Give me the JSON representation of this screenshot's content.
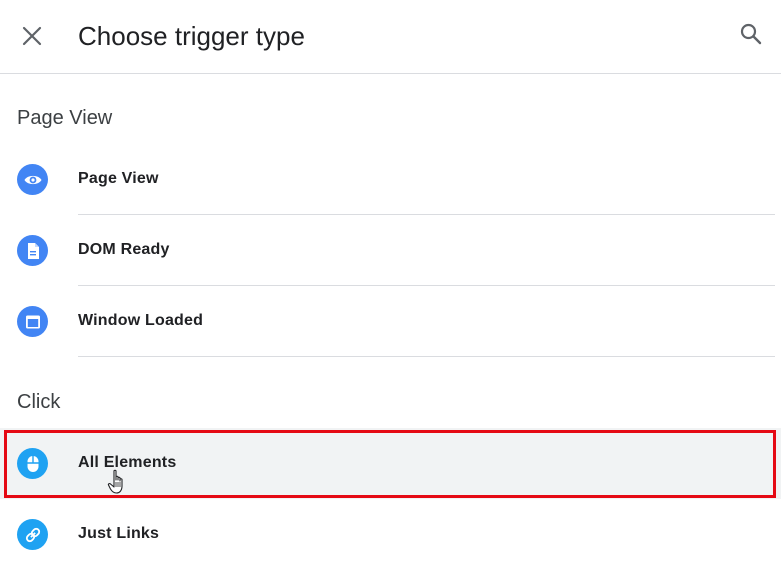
{
  "header": {
    "title": "Choose trigger type",
    "close_icon": "close-icon",
    "search_icon": "search-icon"
  },
  "sections": [
    {
      "title": "Page View",
      "items": [
        {
          "label": "Page View",
          "icon": "eye-icon",
          "color": "#4285f4"
        },
        {
          "label": "DOM Ready",
          "icon": "document-icon",
          "color": "#4285f4"
        },
        {
          "label": "Window Loaded",
          "icon": "window-icon",
          "color": "#4285f4"
        }
      ]
    },
    {
      "title": "Click",
      "items": [
        {
          "label": "All Elements",
          "icon": "mouse-icon",
          "color": "#1fa2f2",
          "highlighted": true
        },
        {
          "label": "Just Links",
          "icon": "link-icon",
          "color": "#1fa2f2"
        }
      ]
    }
  ],
  "colors": {
    "highlight_border": "#e50914",
    "highlight_background": "#f1f3f4",
    "divider": "#dadce0"
  }
}
